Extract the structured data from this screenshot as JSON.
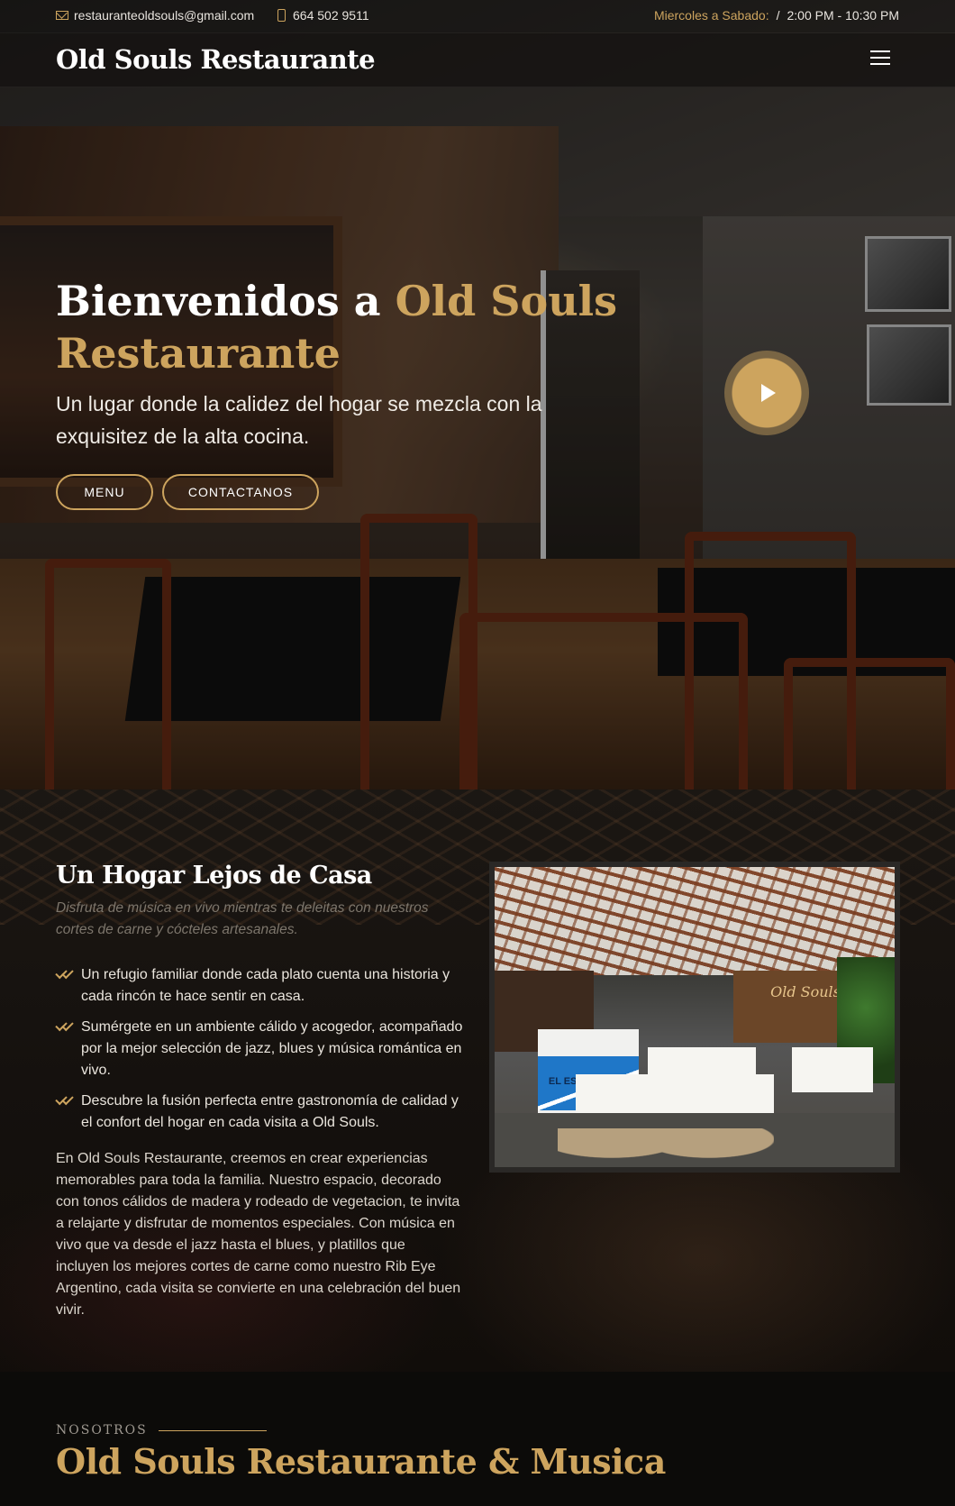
{
  "topbar": {
    "email": "restauranteoldsouls@gmail.com",
    "phone": "664 502 9511",
    "days": "Miercoles a Sabado:",
    "separator": "/",
    "hours": "2:00 PM - 10:30 PM"
  },
  "header": {
    "logo": "Old Souls Restaurante"
  },
  "hero": {
    "title_white": "Bienvenidos a ",
    "title_gold": "Old Souls Restaurante",
    "subtitle": "Un lugar donde la calidez del hogar se mezcla con la exquisitez de la alta cocina.",
    "buttons": {
      "menu": "MENU",
      "contact": "CONTACTANOS"
    }
  },
  "about": {
    "title": "Un Hogar Lejos de Casa",
    "italic": "Disfruta de música en vivo mientras te deleitas con nuestros cortes de carne y cócteles artesanales.",
    "items": [
      "Un refugio familiar donde cada plato cuenta una historia y cada rincón te hace sentir en casa.",
      "Sumérgete en un ambiente cálido y acogedor, acompañado por la mejor selección de jazz, blues y música romántica en vivo.",
      "Descubre la fusión perfecta entre gastronomía de calidad y el confort del hogar en cada visita a Old Souls."
    ],
    "body": "En Old Souls Restaurante, creemos en crear experiencias memorables para toda la familia. Nuestro espacio, decorado con tonos cálidos de madera y rodeado de vegetacion, te invita a relajarte y disfrutar de momentos especiales. Con música en vivo que va desde el jazz hasta el blues, y platillos que incluyen los mejores cortes de carne como nuestro Rib Eye Argentino, cada visita se convierte en una celebración del buen vivir.",
    "photo": {
      "sign_text": "Old Souls",
      "stand_text": "EL ESTANCIERO"
    }
  },
  "nosotros": {
    "label": "NOSOTROS",
    "title": "Old Souls Restaurante & Musica"
  },
  "colors": {
    "accent": "#cda45e",
    "background": "#0c0b09"
  }
}
